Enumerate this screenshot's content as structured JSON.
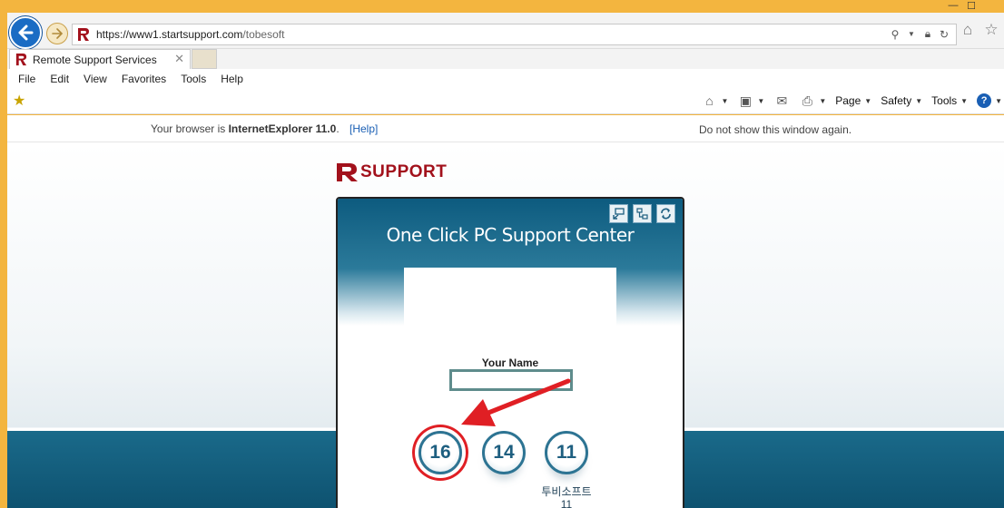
{
  "browser": {
    "url_prefix": "https://www1.",
    "url_domain": "startsupport.com",
    "url_path": "/tobesoft",
    "tab_title": "Remote Support Services",
    "tab_close": "✕",
    "menu": [
      "File",
      "Edit",
      "View",
      "Favorites",
      "Tools",
      "Help"
    ],
    "command_bar": {
      "page": "Page",
      "safety": "Safety",
      "tools": "Tools"
    }
  },
  "info_bar": {
    "prefix": "Your browser is ",
    "browser_name": "InternetExplorer 11.0",
    "suffix": ".",
    "help_link": "[Help]",
    "dismiss": "Do not show this window again."
  },
  "brand": {
    "text": "SUPPORT"
  },
  "panel": {
    "title": "One Click PC Support Center",
    "name_label": "Your Name",
    "name_value": "",
    "codes": [
      {
        "label": "16",
        "caption": ""
      },
      {
        "label": "14",
        "caption": ""
      },
      {
        "label": "11",
        "caption": "투비소프트\n11"
      }
    ]
  },
  "colors": {
    "accent_red": "#e01f24",
    "brand_red": "#a2111c",
    "panel_blue": "#0d5b7f",
    "ie_frame": "#f3b53f"
  }
}
